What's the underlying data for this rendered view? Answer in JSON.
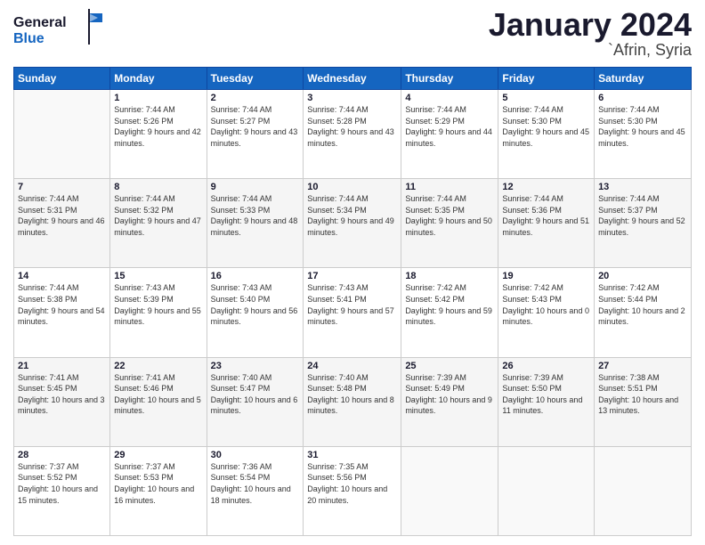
{
  "header": {
    "logo_general": "General",
    "logo_blue": "Blue",
    "month_year": "January 2024",
    "location": "`Afrin, Syria"
  },
  "weekdays": [
    "Sunday",
    "Monday",
    "Tuesday",
    "Wednesday",
    "Thursday",
    "Friday",
    "Saturday"
  ],
  "weeks": [
    [
      {
        "day": "",
        "sunrise": "",
        "sunset": "",
        "daylight": ""
      },
      {
        "day": "1",
        "sunrise": "Sunrise: 7:44 AM",
        "sunset": "Sunset: 5:26 PM",
        "daylight": "Daylight: 9 hours and 42 minutes."
      },
      {
        "day": "2",
        "sunrise": "Sunrise: 7:44 AM",
        "sunset": "Sunset: 5:27 PM",
        "daylight": "Daylight: 9 hours and 43 minutes."
      },
      {
        "day": "3",
        "sunrise": "Sunrise: 7:44 AM",
        "sunset": "Sunset: 5:28 PM",
        "daylight": "Daylight: 9 hours and 43 minutes."
      },
      {
        "day": "4",
        "sunrise": "Sunrise: 7:44 AM",
        "sunset": "Sunset: 5:29 PM",
        "daylight": "Daylight: 9 hours and 44 minutes."
      },
      {
        "day": "5",
        "sunrise": "Sunrise: 7:44 AM",
        "sunset": "Sunset: 5:30 PM",
        "daylight": "Daylight: 9 hours and 45 minutes."
      },
      {
        "day": "6",
        "sunrise": "Sunrise: 7:44 AM",
        "sunset": "Sunset: 5:30 PM",
        "daylight": "Daylight: 9 hours and 45 minutes."
      }
    ],
    [
      {
        "day": "7",
        "sunrise": "Sunrise: 7:44 AM",
        "sunset": "Sunset: 5:31 PM",
        "daylight": "Daylight: 9 hours and 46 minutes."
      },
      {
        "day": "8",
        "sunrise": "Sunrise: 7:44 AM",
        "sunset": "Sunset: 5:32 PM",
        "daylight": "Daylight: 9 hours and 47 minutes."
      },
      {
        "day": "9",
        "sunrise": "Sunrise: 7:44 AM",
        "sunset": "Sunset: 5:33 PM",
        "daylight": "Daylight: 9 hours and 48 minutes."
      },
      {
        "day": "10",
        "sunrise": "Sunrise: 7:44 AM",
        "sunset": "Sunset: 5:34 PM",
        "daylight": "Daylight: 9 hours and 49 minutes."
      },
      {
        "day": "11",
        "sunrise": "Sunrise: 7:44 AM",
        "sunset": "Sunset: 5:35 PM",
        "daylight": "Daylight: 9 hours and 50 minutes."
      },
      {
        "day": "12",
        "sunrise": "Sunrise: 7:44 AM",
        "sunset": "Sunset: 5:36 PM",
        "daylight": "Daylight: 9 hours and 51 minutes."
      },
      {
        "day": "13",
        "sunrise": "Sunrise: 7:44 AM",
        "sunset": "Sunset: 5:37 PM",
        "daylight": "Daylight: 9 hours and 52 minutes."
      }
    ],
    [
      {
        "day": "14",
        "sunrise": "Sunrise: 7:44 AM",
        "sunset": "Sunset: 5:38 PM",
        "daylight": "Daylight: 9 hours and 54 minutes."
      },
      {
        "day": "15",
        "sunrise": "Sunrise: 7:43 AM",
        "sunset": "Sunset: 5:39 PM",
        "daylight": "Daylight: 9 hours and 55 minutes."
      },
      {
        "day": "16",
        "sunrise": "Sunrise: 7:43 AM",
        "sunset": "Sunset: 5:40 PM",
        "daylight": "Daylight: 9 hours and 56 minutes."
      },
      {
        "day": "17",
        "sunrise": "Sunrise: 7:43 AM",
        "sunset": "Sunset: 5:41 PM",
        "daylight": "Daylight: 9 hours and 57 minutes."
      },
      {
        "day": "18",
        "sunrise": "Sunrise: 7:42 AM",
        "sunset": "Sunset: 5:42 PM",
        "daylight": "Daylight: 9 hours and 59 minutes."
      },
      {
        "day": "19",
        "sunrise": "Sunrise: 7:42 AM",
        "sunset": "Sunset: 5:43 PM",
        "daylight": "Daylight: 10 hours and 0 minutes."
      },
      {
        "day": "20",
        "sunrise": "Sunrise: 7:42 AM",
        "sunset": "Sunset: 5:44 PM",
        "daylight": "Daylight: 10 hours and 2 minutes."
      }
    ],
    [
      {
        "day": "21",
        "sunrise": "Sunrise: 7:41 AM",
        "sunset": "Sunset: 5:45 PM",
        "daylight": "Daylight: 10 hours and 3 minutes."
      },
      {
        "day": "22",
        "sunrise": "Sunrise: 7:41 AM",
        "sunset": "Sunset: 5:46 PM",
        "daylight": "Daylight: 10 hours and 5 minutes."
      },
      {
        "day": "23",
        "sunrise": "Sunrise: 7:40 AM",
        "sunset": "Sunset: 5:47 PM",
        "daylight": "Daylight: 10 hours and 6 minutes."
      },
      {
        "day": "24",
        "sunrise": "Sunrise: 7:40 AM",
        "sunset": "Sunset: 5:48 PM",
        "daylight": "Daylight: 10 hours and 8 minutes."
      },
      {
        "day": "25",
        "sunrise": "Sunrise: 7:39 AM",
        "sunset": "Sunset: 5:49 PM",
        "daylight": "Daylight: 10 hours and 9 minutes."
      },
      {
        "day": "26",
        "sunrise": "Sunrise: 7:39 AM",
        "sunset": "Sunset: 5:50 PM",
        "daylight": "Daylight: 10 hours and 11 minutes."
      },
      {
        "day": "27",
        "sunrise": "Sunrise: 7:38 AM",
        "sunset": "Sunset: 5:51 PM",
        "daylight": "Daylight: 10 hours and 13 minutes."
      }
    ],
    [
      {
        "day": "28",
        "sunrise": "Sunrise: 7:37 AM",
        "sunset": "Sunset: 5:52 PM",
        "daylight": "Daylight: 10 hours and 15 minutes."
      },
      {
        "day": "29",
        "sunrise": "Sunrise: 7:37 AM",
        "sunset": "Sunset: 5:53 PM",
        "daylight": "Daylight: 10 hours and 16 minutes."
      },
      {
        "day": "30",
        "sunrise": "Sunrise: 7:36 AM",
        "sunset": "Sunset: 5:54 PM",
        "daylight": "Daylight: 10 hours and 18 minutes."
      },
      {
        "day": "31",
        "sunrise": "Sunrise: 7:35 AM",
        "sunset": "Sunset: 5:56 PM",
        "daylight": "Daylight: 10 hours and 20 minutes."
      },
      {
        "day": "",
        "sunrise": "",
        "sunset": "",
        "daylight": ""
      },
      {
        "day": "",
        "sunrise": "",
        "sunset": "",
        "daylight": ""
      },
      {
        "day": "",
        "sunrise": "",
        "sunset": "",
        "daylight": ""
      }
    ]
  ]
}
